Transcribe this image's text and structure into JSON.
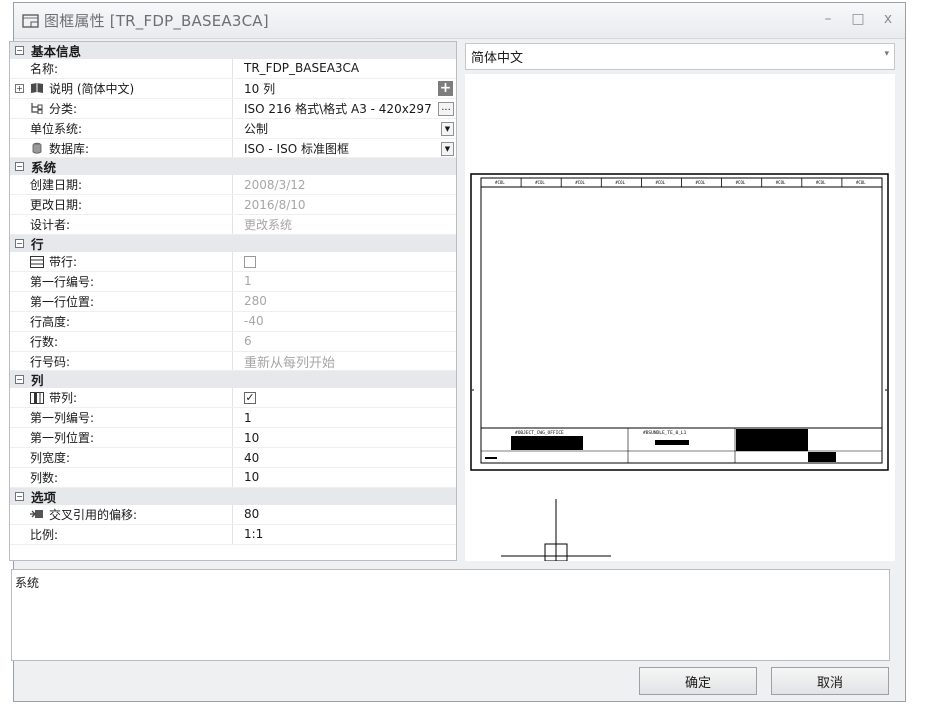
{
  "window": {
    "title": "图框属性 [TR_FDP_BASEA3CA]",
    "controls": [
      "–",
      "□",
      "x"
    ]
  },
  "grid": {
    "basic": {
      "header": "基本信息",
      "name_label": "名称:",
      "name_value": "TR_FDP_BASEA3CA",
      "desc_label": "说明 (简体中文)",
      "desc_value": "10 列",
      "cls_label": "分类:",
      "cls_value": "ISO 216 格式\\格式 A3 - 420x297",
      "cls_more": "...",
      "unit_label": "单位系统:",
      "unit_value": "公制",
      "db_label": "数据库:",
      "db_value": "ISO - ISO 标准图框"
    },
    "system": {
      "header": "系统",
      "created_label": "创建日期:",
      "created_value": "2008/3/12",
      "modified_label": "更改日期:",
      "modified_value": "2016/8/10",
      "designer_label": "设计者:",
      "designer_value": "更改系统"
    },
    "rows": {
      "header": "行",
      "with_label": "带行:",
      "with_checked": "",
      "first_no_label": "第一行编号:",
      "first_no_value": "1",
      "first_pos_label": "第一行位置:",
      "first_pos_value": "280",
      "height_label": "行高度:",
      "height_value": "-40",
      "count_label": "行数:",
      "count_value": "6",
      "code_label": "行号码:",
      "code_value": "重新从每列开始"
    },
    "cols": {
      "header": "列",
      "with_label": "带列:",
      "with_checked": "✓",
      "first_no_label": "第一列编号:",
      "first_no_value": "1",
      "first_pos_label": "第一列位置:",
      "first_pos_value": "10",
      "width_label": "列宽度:",
      "width_value": "40",
      "count_label": "列数:",
      "count_value": "10"
    },
    "options": {
      "header": "选项",
      "xref_label": "交叉引用的偏移:",
      "xref_value": "80",
      "scale_label": "比例:",
      "scale_value": "1:1"
    }
  },
  "language_select": {
    "value": "简体中文"
  },
  "preview": {
    "column_header": "#COL",
    "title_block_texts": [
      "#OBJECT_CWG_OFFICE",
      "#BSUNDLE_TE_0_L1"
    ]
  },
  "description_box": {
    "text": "系统"
  },
  "buttons": {
    "ok": "确定",
    "cancel": "取消"
  }
}
